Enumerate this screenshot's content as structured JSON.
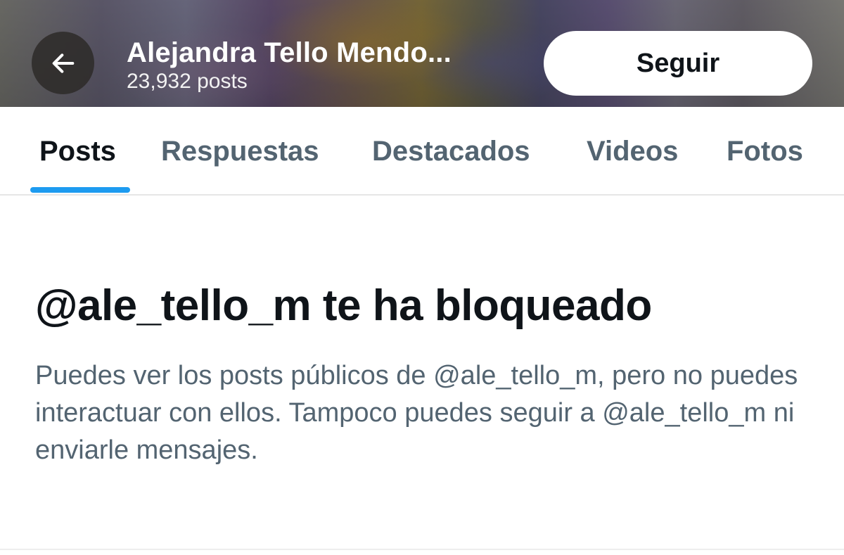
{
  "header": {
    "name": "Alejandra Tello Mendo...",
    "post_count": "23,932 posts",
    "follow_label": "Seguir"
  },
  "tabs": [
    {
      "label": "Posts",
      "active": true
    },
    {
      "label": "Respuestas",
      "active": false
    },
    {
      "label": "Destacados",
      "active": false
    },
    {
      "label": "Videos",
      "active": false
    },
    {
      "label": "Fotos",
      "active": false
    }
  ],
  "blocked": {
    "title": "@ale_tello_m te ha bloqueado",
    "description": "Puedes ver los posts públicos de @ale_tello_m, pero no puedes interactuar con ellos. Tampoco puedes seguir a @ale_tello_m ni enviarle mensajes."
  },
  "icons": {
    "back": "arrow-left-icon"
  },
  "colors": {
    "accent": "#1d9bf0",
    "text_primary": "#0f1419",
    "text_secondary": "#536471"
  }
}
